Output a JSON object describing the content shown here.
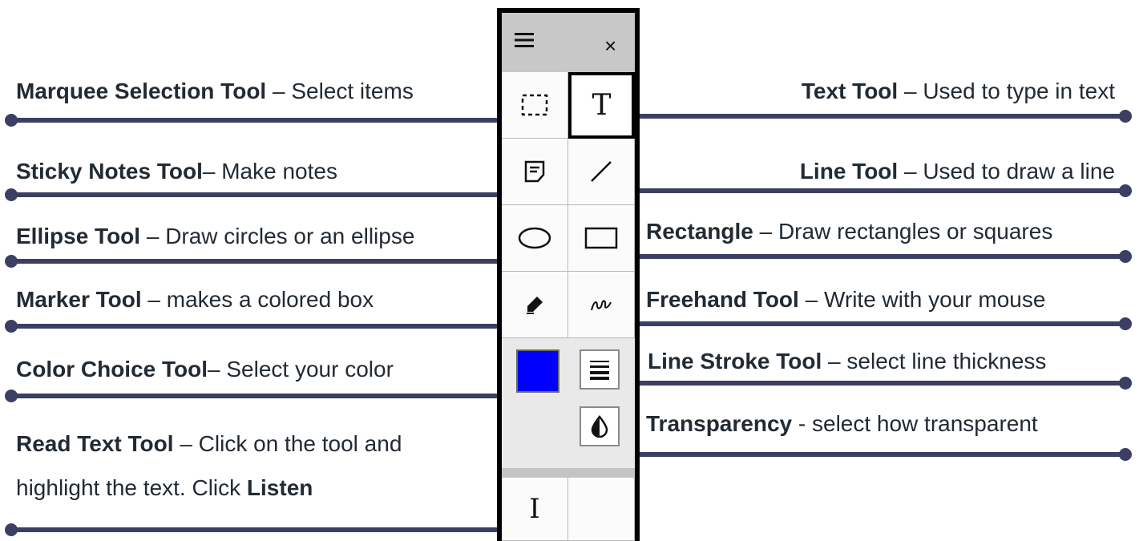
{
  "toolbar": {
    "menu_icon": "hamburger-menu-icon",
    "close_label": "×",
    "selected_color": "#0000ff",
    "tools": [
      {
        "icon": "marquee-icon"
      },
      {
        "icon": "text-tool-icon",
        "glyph": "T"
      },
      {
        "icon": "sticky-note-icon"
      },
      {
        "icon": "line-icon"
      },
      {
        "icon": "ellipse-icon"
      },
      {
        "icon": "rectangle-icon"
      },
      {
        "icon": "marker-icon"
      },
      {
        "icon": "freehand-icon"
      },
      {
        "icon": "color-swatch"
      },
      {
        "icon": "line-stroke-icon"
      },
      {
        "icon": "transparency-icon"
      },
      {
        "icon": "read-text-cursor-icon",
        "glyph": "I"
      }
    ]
  },
  "labels": {
    "marquee": {
      "bold": "Marquee Selection Tool",
      "rest": " – Select items"
    },
    "text_tool": {
      "bold": "Text Tool",
      "rest": " – Used to type in text"
    },
    "sticky": {
      "bold": "Sticky Notes Tool",
      "rest": "– Make notes"
    },
    "line": {
      "bold": "Line Tool",
      "rest": " – Used to draw a line"
    },
    "ellipse": {
      "bold": "Ellipse Tool",
      "rest": " – Draw circles or an ellipse"
    },
    "rectangle": {
      "bold": "Rectangle",
      "rest": " – Draw rectangles or squares"
    },
    "marker": {
      "bold": "Marker Tool",
      "rest": " – makes a colored box"
    },
    "freehand": {
      "bold": "Freehand Tool",
      "rest": " – Write with your mouse"
    },
    "color": {
      "bold": "Color Choice Tool",
      "rest": "– Select your color"
    },
    "stroke": {
      "bold": "Line Stroke Tool",
      "rest": " – select line thickness"
    },
    "transparency": {
      "bold": "Transparency",
      "rest": " - select how transparent"
    },
    "read_text": {
      "bold": "Read Text Tool",
      "rest": " – Click on the tool and"
    },
    "read_text_2": {
      "rest": "highlight the text.  Click ",
      "bold": "Listen"
    }
  },
  "colors": {
    "connector": "#3c3f63",
    "text": "#222a33"
  }
}
